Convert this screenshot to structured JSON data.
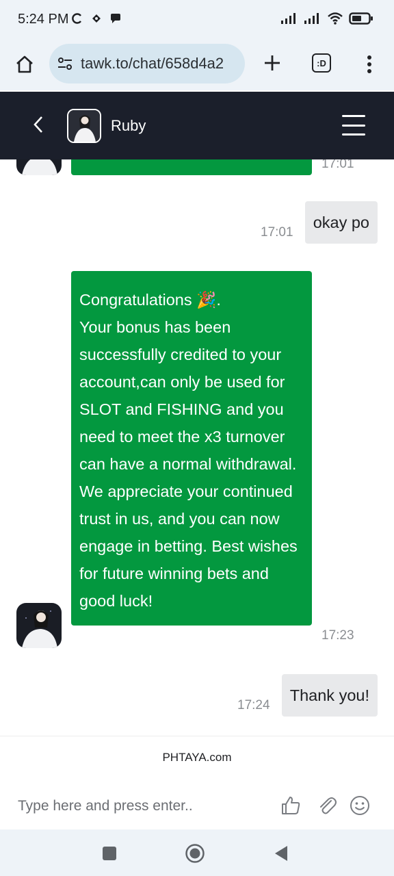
{
  "status_bar": {
    "time": "5:24 PM"
  },
  "browser": {
    "url": "tawk.to/chat/658d4a2",
    "tabs_label": ":D"
  },
  "chat_header": {
    "agent_name": "Ruby"
  },
  "messages": [
    {
      "sender": "agent",
      "text": "",
      "time": "17:01",
      "partial": true
    },
    {
      "sender": "user",
      "text": "okay po",
      "time": "17:01"
    },
    {
      "sender": "agent",
      "text_line1": "Congratulations 🎉.",
      "text_body": "Your bonus has been successfully credited to your account,can only be used for SLOT and FISHING and you need to meet the x3 turnover can have a normal withdrawal. We appreciate your continued trust in us, and you can now engage in betting. Best wishes for future winning bets and good luck!",
      "time": "17:23"
    },
    {
      "sender": "user",
      "text": "Thank you!",
      "time": "17:24"
    }
  ],
  "footer": {
    "brand": "PHTAYA.com",
    "input_placeholder": "Type here and press enter.."
  },
  "colors": {
    "agent_bubble": "#03983f",
    "user_bubble": "#e8e9eb",
    "header_bg": "#1b1f2b",
    "browser_bg": "#eef3f8"
  }
}
